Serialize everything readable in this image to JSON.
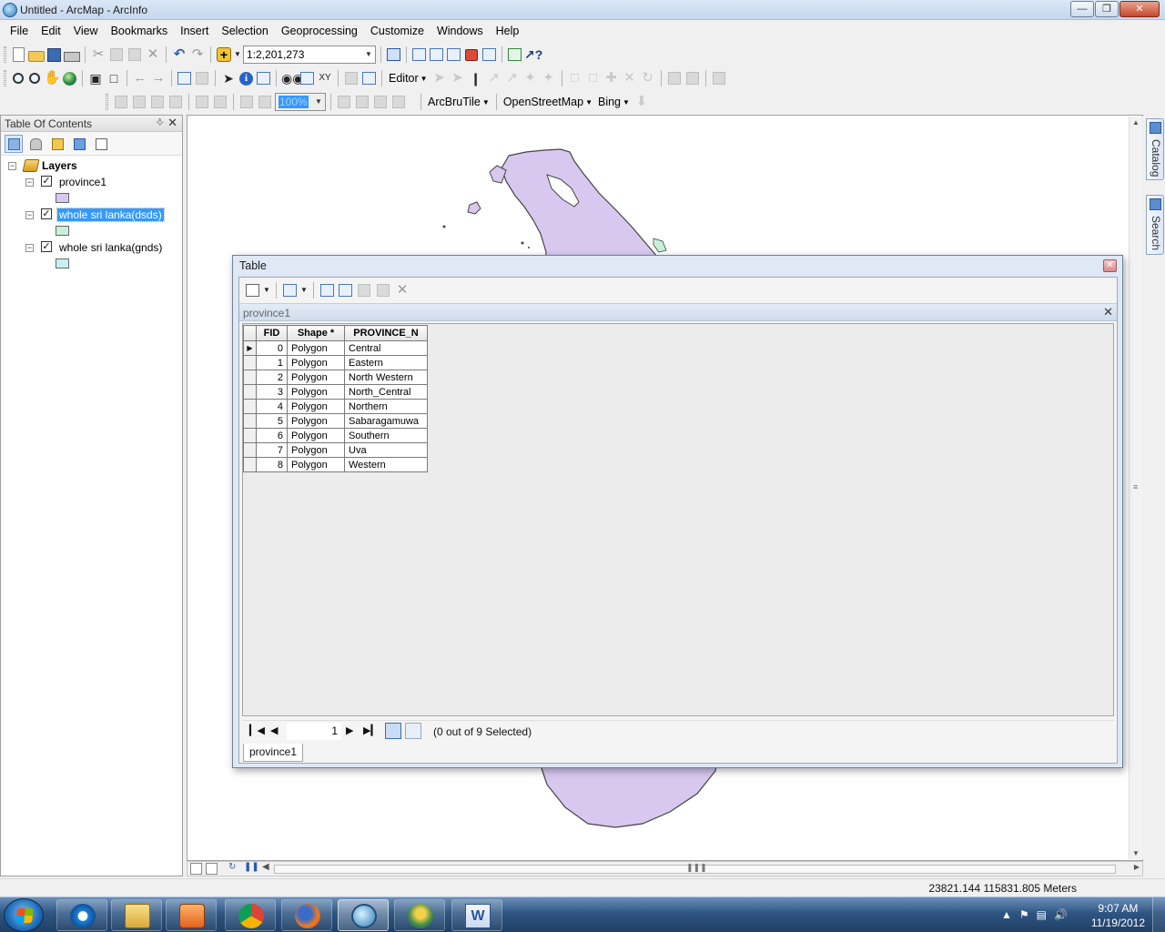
{
  "window": {
    "title": "Untitled - ArcMap - ArcInfo"
  },
  "menu": [
    "File",
    "Edit",
    "View",
    "Bookmarks",
    "Insert",
    "Selection",
    "Geoprocessing",
    "Customize",
    "Windows",
    "Help"
  ],
  "toolbar": {
    "scale": "1:2,201,273",
    "editor_label": "Editor",
    "zoom_percent": "100%",
    "arcbrutile_label": "ArcBruTile",
    "openstreetmap_label": "OpenStreetMap",
    "bing_label": "Bing"
  },
  "toc": {
    "title": "Table Of Contents",
    "root_label": "Layers",
    "layers": [
      {
        "name": "province1",
        "checked": true,
        "selected": false,
        "color": "#d8c8f0"
      },
      {
        "name": "whole sri lanka(dsds)",
        "checked": true,
        "selected": true,
        "color": "#c8f0d8"
      },
      {
        "name": "whole sri lanka(gnds)",
        "checked": true,
        "selected": false,
        "color": "#c8eef4"
      }
    ]
  },
  "side_tabs": [
    "Catalog",
    "Search"
  ],
  "table_window": {
    "title": "Table",
    "tab_name": "province1",
    "columns": [
      "FID",
      "Shape *",
      "PROVINCE_N"
    ],
    "rows": [
      [
        "0",
        "Polygon",
        "Central"
      ],
      [
        "1",
        "Polygon",
        "Eastern"
      ],
      [
        "2",
        "Polygon",
        "North Western"
      ],
      [
        "3",
        "Polygon",
        "North_Central"
      ],
      [
        "4",
        "Polygon",
        "Northern"
      ],
      [
        "5",
        "Polygon",
        "Sabaragamuwa"
      ],
      [
        "6",
        "Polygon",
        "Southern"
      ],
      [
        "7",
        "Polygon",
        "Uva"
      ],
      [
        "8",
        "Polygon",
        "Western"
      ]
    ],
    "current_record": "1",
    "selection_status": "(0 out of 9 Selected)",
    "bottom_tab": "province1"
  },
  "status": {
    "coordinates": "23821.144  115831.805 Meters"
  },
  "taskbar": {
    "time": "9:07 AM",
    "date": "11/19/2012"
  },
  "colors": {
    "map_fill": "#d8c8f0",
    "selection_blue": "#3399ff"
  }
}
